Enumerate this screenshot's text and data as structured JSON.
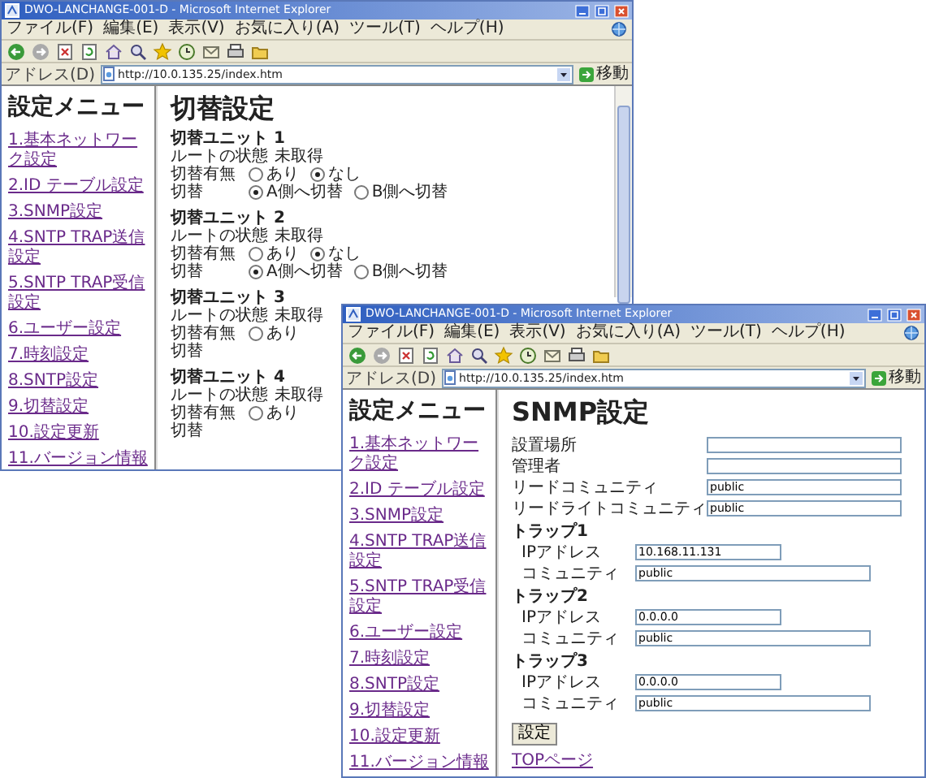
{
  "windows": [
    {
      "kind": "switch",
      "title": "DWO-LANCHANGE-001-D - Microsoft Internet Explorer",
      "menu": [
        "ファイル(F)",
        "編集(E)",
        "表示(V)",
        "お気に入り(A)",
        "ツール(T)",
        "ヘルプ(H)"
      ],
      "address_label": "アドレス(D)",
      "url": "http://10.0.135.25/index.htm",
      "go_button": "移動",
      "sidebar": {
        "heading": "設定メニュー",
        "items": [
          "1.基本ネットワーク設定",
          "2.ID テーブル設定",
          "3.SNMP設定",
          "4.SNTP TRAP送信設定",
          "5.SNTP TRAP受信設定",
          "6.ユーザー設定",
          "7.時刻設定",
          "8.SNTP設定",
          "9.切替設定",
          "10.設定更新",
          "11.バージョン情報"
        ]
      },
      "page": {
        "heading": "切替設定",
        "units": [
          {
            "title": "切替ユニット 1",
            "rows": [
              {
                "kind": "status",
                "label": "ルートの状態",
                "value": "未取得"
              },
              {
                "kind": "radio",
                "label": "切替有無",
                "options": [
                  {
                    "text": "あり",
                    "selected": false
                  },
                  {
                    "text": "なし",
                    "selected": true
                  }
                ]
              },
              {
                "kind": "radio",
                "label": "切替",
                "options": [
                  {
                    "text": "A側へ切替",
                    "selected": true
                  },
                  {
                    "text": "B側へ切替",
                    "selected": false
                  }
                ]
              }
            ]
          },
          {
            "title": "切替ユニット 2",
            "rows": [
              {
                "kind": "status",
                "label": "ルートの状態",
                "value": "未取得"
              },
              {
                "kind": "radio",
                "label": "切替有無",
                "options": [
                  {
                    "text": "あり",
                    "selected": false
                  },
                  {
                    "text": "なし",
                    "selected": true
                  }
                ]
              },
              {
                "kind": "radio",
                "label": "切替",
                "options": [
                  {
                    "text": "A側へ切替",
                    "selected": true
                  },
                  {
                    "text": "B側へ切替",
                    "selected": false
                  }
                ]
              }
            ]
          },
          {
            "title": "切替ユニット 3",
            "rows": [
              {
                "kind": "status",
                "label": "ルートの状態",
                "value": "未取得"
              },
              {
                "kind": "radio",
                "label": "切替有無",
                "options": [
                  {
                    "text": "あり",
                    "selected": false
                  }
                ]
              },
              {
                "kind": "radio",
                "label": "切替"
              }
            ]
          },
          {
            "title": "切替ユニット 4",
            "rows": [
              {
                "kind": "status",
                "label": "ルートの状態",
                "value": "未取得"
              },
              {
                "kind": "radio",
                "label": "切替有無",
                "options": [
                  {
                    "text": "あり",
                    "selected": false
                  }
                ]
              },
              {
                "kind": "radio",
                "label": "切替"
              }
            ]
          }
        ]
      }
    },
    {
      "kind": "snmp",
      "title": "DWO-LANCHANGE-001-D - Microsoft Internet Explorer",
      "menu": [
        "ファイル(F)",
        "編集(E)",
        "表示(V)",
        "お気に入り(A)",
        "ツール(T)",
        "ヘルプ(H)"
      ],
      "address_label": "アドレス(D)",
      "url": "http://10.0.135.25/index.htm",
      "go_button": "移動",
      "sidebar": {
        "heading": "設定メニュー",
        "items": [
          "1.基本ネットワーク設定",
          "2.ID テーブル設定",
          "3.SNMP設定",
          "4.SNTP TRAP送信設定",
          "5.SNTP TRAP受信設定",
          "6.ユーザー設定",
          "7.時刻設定",
          "8.SNTP設定",
          "9.切替設定",
          "10.設定更新",
          "11.バージョン情報"
        ]
      },
      "page": {
        "heading": "SNMP設定",
        "fields": [
          {
            "label": "設置場所"
          },
          {
            "label": "管理者"
          },
          {
            "label": "リードコミュニティ",
            "value": "public"
          },
          {
            "label": "リードライトコミュニティ",
            "value": "public"
          }
        ],
        "traps": [
          {
            "title": "トラップ1",
            "fields": [
              {
                "kind": "ip",
                "label": "IPアドレス",
                "value": "10.168.11.131"
              },
              {
                "kind": "community",
                "label": "コミュニティ",
                "value": "public"
              }
            ]
          },
          {
            "title": "トラップ2",
            "fields": [
              {
                "kind": "ip",
                "label": "IPアドレス",
                "value": "0.0.0.0"
              },
              {
                "kind": "community",
                "label": "コミュニティ",
                "value": "public"
              }
            ]
          },
          {
            "title": "トラップ3",
            "fields": [
              {
                "kind": "ip",
                "label": "IPアドレス",
                "value": "0.0.0.0"
              },
              {
                "kind": "community",
                "label": "コミュニティ",
                "value": "public"
              }
            ]
          }
        ],
        "submit_button": "設定",
        "top_link": "TOPページ"
      }
    }
  ]
}
